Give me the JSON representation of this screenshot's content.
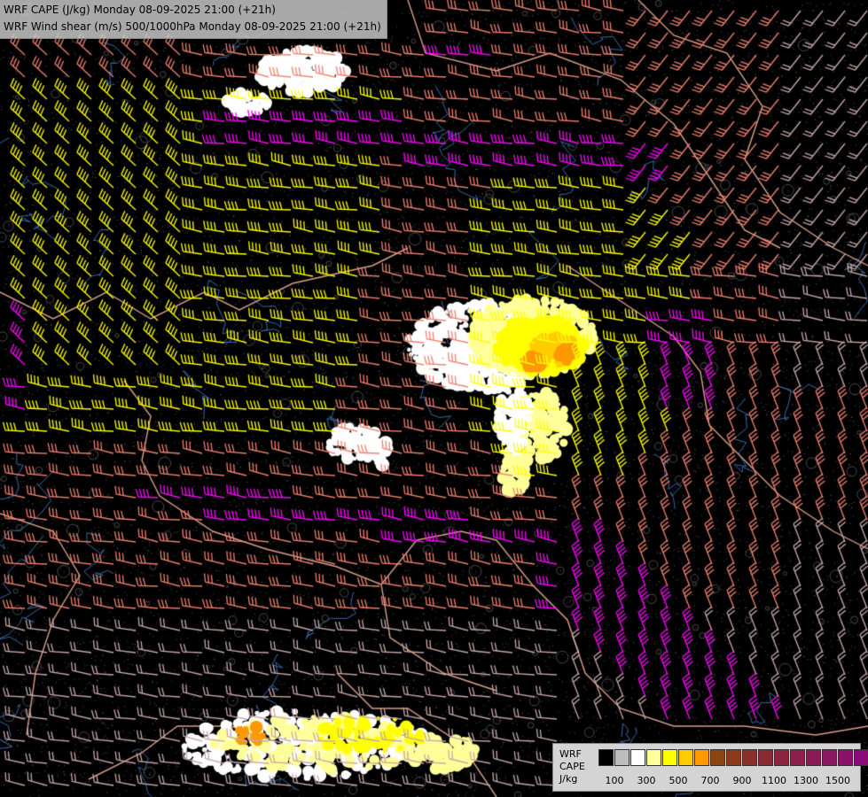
{
  "header": {
    "line1": "WRF CAPE (J/kg) Monday 08-09-2025 21:00 (+21h)",
    "line2": "WRF Wind shear (m/s) 500/1000hPa Monday 08-09-2025 21:00 (+21h)"
  },
  "legend": {
    "model": "WRF",
    "field": "CAPE",
    "unit": "J/kg",
    "colors": [
      "#000000",
      "#bebebe",
      "#ffffff",
      "#ffff99",
      "#ffff00",
      "#ffcc00",
      "#ff9900",
      "#8b4513",
      "#8b3a1a",
      "#8b2f2a",
      "#8b2a35",
      "#8b2540",
      "#8b204b",
      "#8b1b56",
      "#8b1661",
      "#8b116c",
      "#8b0c77"
    ],
    "ticks": [
      "100",
      "300",
      "500",
      "700",
      "900",
      "1100",
      "1300",
      "1500"
    ]
  },
  "map": {
    "barb_colors": {
      "low": "#c8a8a8",
      "moderate": "#f08070",
      "strong": "#ffff00",
      "very_strong": "#ff00ff"
    },
    "border_color": "#d9a08a",
    "river_color": "#3a6aa8"
  }
}
